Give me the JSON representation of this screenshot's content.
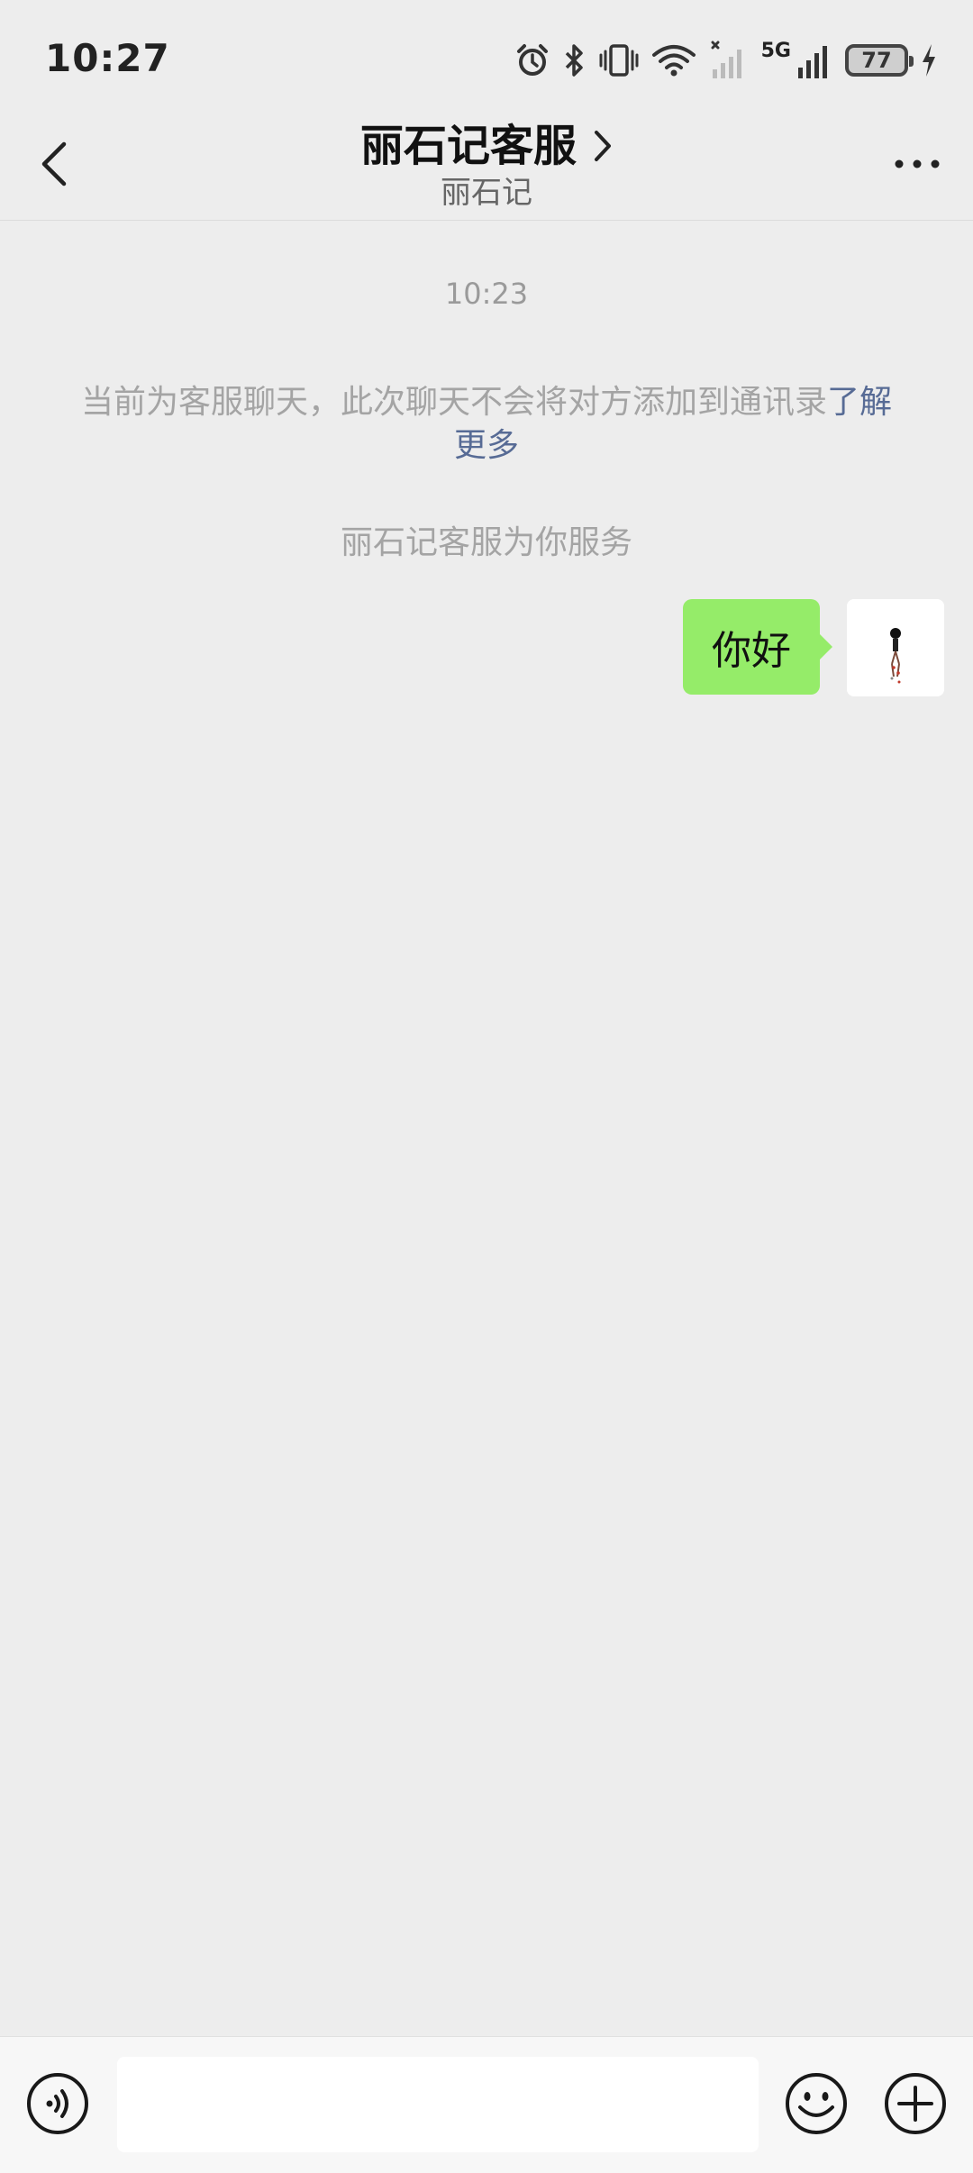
{
  "status_bar": {
    "time": "10:27",
    "network_type": "5G",
    "battery_level": "77",
    "icons": [
      "alarm-icon",
      "bluetooth-icon",
      "vibrate-icon",
      "wifi-icon",
      "signal-icon",
      "signal-icon",
      "charging-icon"
    ]
  },
  "header": {
    "title": "丽石记客服",
    "subtitle": "丽石记",
    "back_icon": "chevron-left-icon",
    "title_icon": "chevron-right-icon",
    "more_icon": "more-dots-icon"
  },
  "chat": {
    "timestamp": "10:23",
    "system_notice_text": "当前为客服聊天，此次聊天不会将对方添加到通讯录",
    "system_notice_link": "了解更多",
    "service_notice": "丽石记客服为你服务",
    "messages": [
      {
        "sender": "me",
        "text": "你好"
      }
    ]
  },
  "input_bar": {
    "voice_icon": "voice-icon",
    "input_value": "",
    "emoji_icon": "emoji-icon",
    "plus_icon": "plus-icon"
  },
  "colors": {
    "background": "#ededed",
    "bubble_self": "#95ec69",
    "link": "#576b95",
    "muted_text": "#a4a4a4"
  }
}
